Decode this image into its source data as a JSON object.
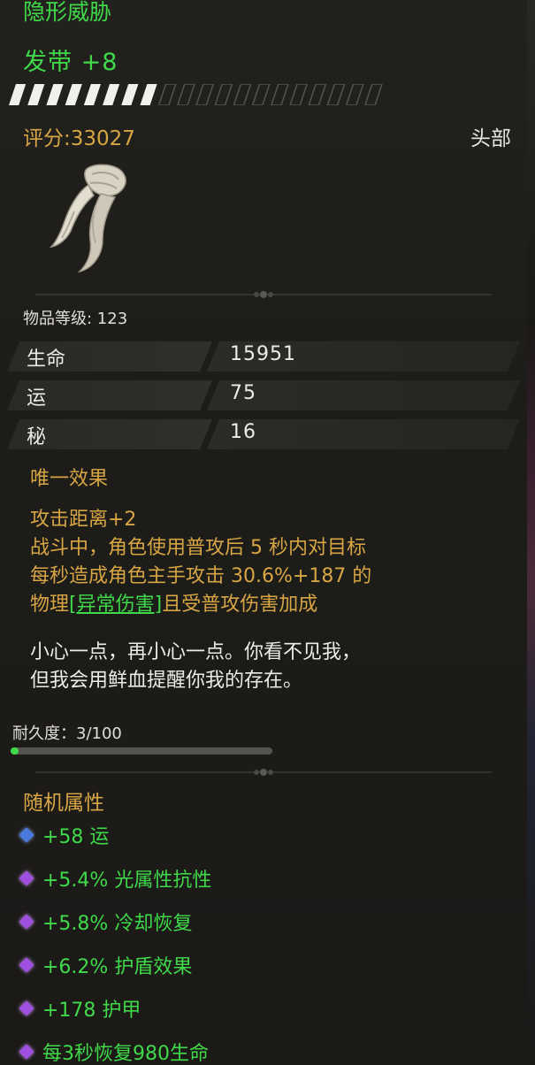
{
  "item": {
    "series": "隐形威胁",
    "name": "发带 +8",
    "score": "评分:33027",
    "slot": "头部",
    "level": "物品等级: 123",
    "enhance": {
      "filled": 8,
      "total": 20
    },
    "icon": "headband-icon"
  },
  "stats": [
    {
      "name": "生命",
      "value": "15951"
    },
    {
      "name": "运",
      "value": "75"
    },
    {
      "name": "秘",
      "value": "16"
    }
  ],
  "unique": {
    "title": "唯一效果",
    "line1": "攻击距离+2",
    "line2": "战斗中，角色使用普攻后 5 秒内对目标",
    "line3": "每秒造成角色主手攻击 30.6%+187 的",
    "line4_pre": "物理",
    "line4_link": "[异常伤害]",
    "line4_post": "且受普攻伤害加成"
  },
  "flavor": {
    "line1": "小心一点，再小心一点。你看不见我，",
    "line2": "但我会用鲜血提醒你我的存在。"
  },
  "durability": {
    "label": "耐久度：3/100",
    "current": 3,
    "max": 100
  },
  "random": {
    "title": "随机属性",
    "attrs": [
      {
        "text": "+58 运",
        "gem": "blue"
      },
      {
        "text": "+5.4% 光属性抗性",
        "gem": "purple"
      },
      {
        "text": "+5.8% 冷却恢复",
        "gem": "purple"
      },
      {
        "text": "+6.2% 护盾效果",
        "gem": "purple"
      },
      {
        "text": "+178 护甲",
        "gem": "purple"
      },
      {
        "text": "每3秒恢复980生命",
        "gem": "purple"
      }
    ]
  },
  "colors": {
    "green": "#3fd94a",
    "gold": "#d7a544",
    "gem_blue": "#4a78e0",
    "gem_purple": "#a050e0"
  }
}
